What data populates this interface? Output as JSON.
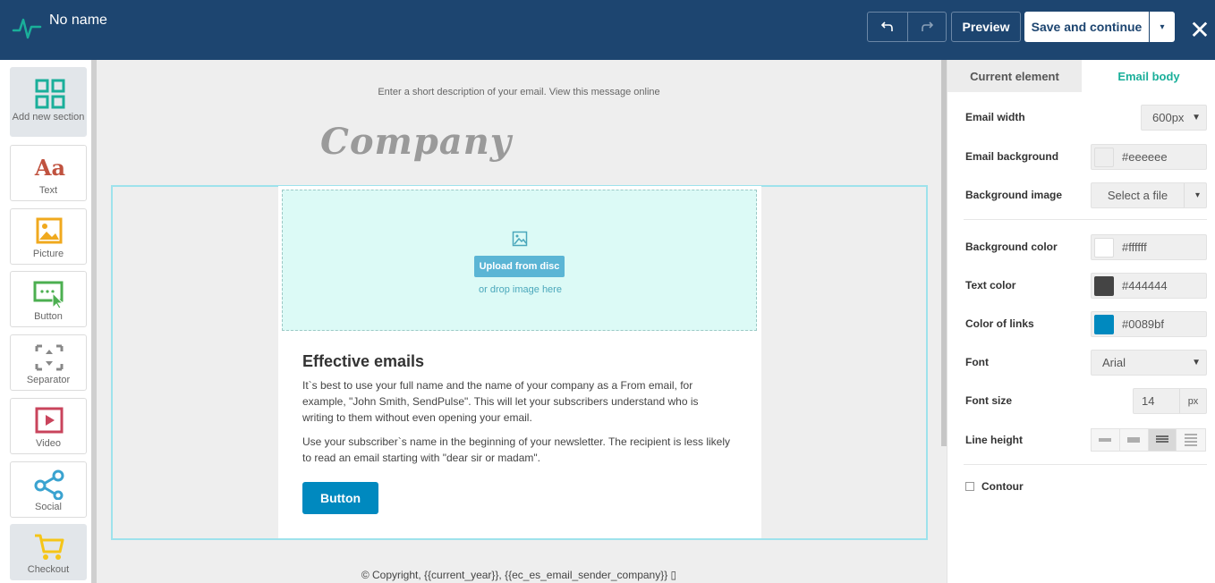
{
  "header": {
    "title": "No name",
    "undo_icon": "undo-icon",
    "redo_icon": "redo-icon",
    "preview_label": "Preview",
    "save_label": "Save and continue",
    "save_caret": "▾",
    "close_label": "✕"
  },
  "palette": {
    "items": [
      {
        "label": "Add new section",
        "icon": "grid-icon",
        "color": "#1aaf9a"
      },
      {
        "label": "Text",
        "icon": "text-icon",
        "glyph": "Aa",
        "color": "#c0523f"
      },
      {
        "label": "Picture",
        "icon": "picture-icon",
        "color": "#f0a91e"
      },
      {
        "label": "Button",
        "icon": "button-cursor-icon",
        "color": "#4caf50"
      },
      {
        "label": "Separator",
        "icon": "separator-icon",
        "color": "#888888"
      },
      {
        "label": "Video",
        "icon": "video-icon",
        "color": "#c9445c"
      },
      {
        "label": "Social",
        "icon": "share-icon",
        "color": "#3aa3d0"
      },
      {
        "label": "Checkout",
        "icon": "cart-icon",
        "color": "#f5c518"
      }
    ]
  },
  "canvas": {
    "preheader": "Enter a short description of your email. View this message online",
    "logo_text": "Company",
    "upload_label": "Upload from disc",
    "drop_text": "or drop image here",
    "heading": "Effective emails",
    "para1": "It`s best to use your full name and the name of your company as a From email, for example, \"John Smith, SendPulse\". This will let your subscribers understand who is writing to them without even opening your email.",
    "para2": "Use your subscriber`s name in the beginning of your newsletter. The recipient is less likely to read an email starting with \"dear sir or madam\".",
    "button_label": "Button",
    "copyright": "© Copyright, {{current_year}}, {{ec_es_email_sender_company}} ▯"
  },
  "panel": {
    "tabs": [
      {
        "label": "Current element",
        "active": false
      },
      {
        "label": "Email body",
        "active": true
      }
    ],
    "email_width_label": "Email width",
    "email_width_value": "600px",
    "email_bg_label": "Email background",
    "email_bg_value": "#eeeeee",
    "bg_image_label": "Background image",
    "bg_image_value": "Select a file",
    "bg_color_label": "Background color",
    "bg_color_value": "#ffffff",
    "text_color_label": "Text color",
    "text_color_value": "#444444",
    "link_color_label": "Color of links",
    "link_color_value": "#0089bf",
    "font_label": "Font",
    "font_value": "Arial",
    "font_size_label": "Font size",
    "font_size_value": "14",
    "font_size_unit": "px",
    "line_height_label": "Line height",
    "line_height_selected": 3,
    "contour_label": "Contour"
  },
  "colors": {
    "header_bg": "#1d4570",
    "accent": "#1aaf9a",
    "link": "#0089bf"
  }
}
